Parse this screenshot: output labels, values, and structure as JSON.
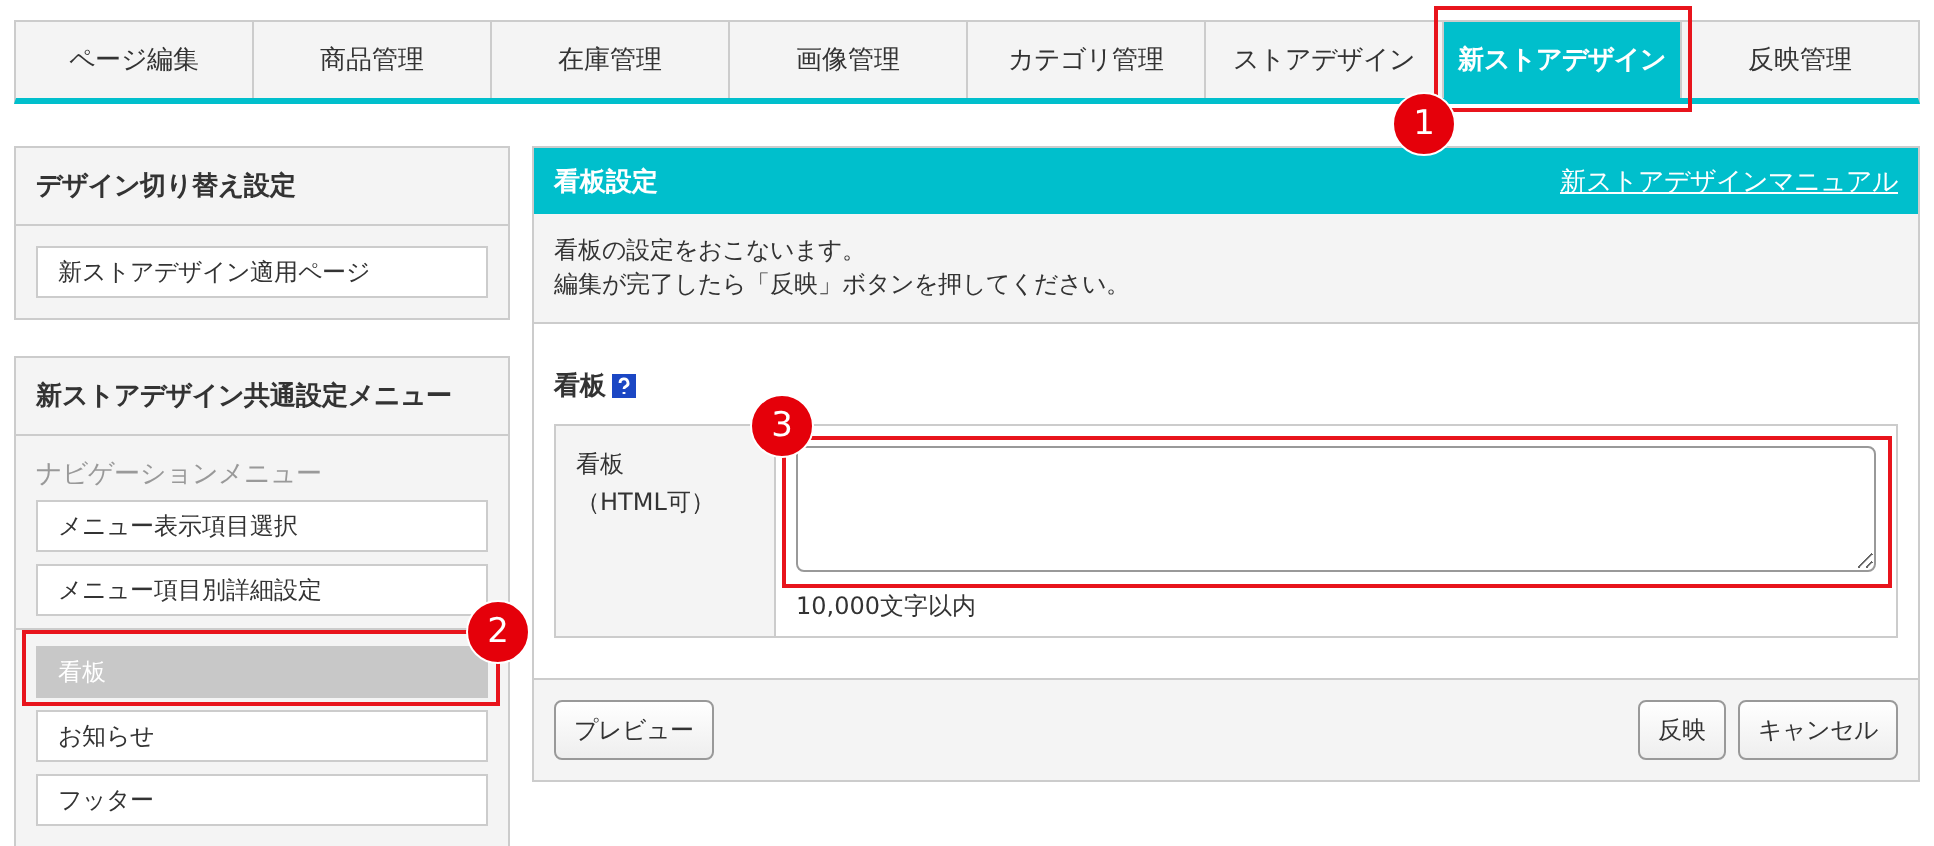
{
  "tabs": [
    {
      "label": "ページ編集",
      "selected": false
    },
    {
      "label": "商品管理",
      "selected": false
    },
    {
      "label": "在庫管理",
      "selected": false
    },
    {
      "label": "画像管理",
      "selected": false
    },
    {
      "label": "カテゴリ管理",
      "selected": false
    },
    {
      "label": "ストアデザイン",
      "selected": false
    },
    {
      "label": "新ストアデザイン",
      "selected": true
    },
    {
      "label": "反映管理",
      "selected": false
    }
  ],
  "sidebar": [
    {
      "title": "デザイン切り替え設定",
      "groups": [
        {
          "items": [
            {
              "label": "新ストアデザイン適用ページ",
              "selected": false
            }
          ]
        }
      ]
    },
    {
      "title": "新ストアデザイン共通設定メニュー",
      "groups": [
        {
          "label": "ナビゲーションメニュー",
          "items": [
            {
              "label": "メニュー表示項目選択",
              "selected": false
            },
            {
              "label": "メニュー項目別詳細設定",
              "selected": false
            }
          ]
        },
        {
          "items": [
            {
              "label": "看板",
              "selected": true
            },
            {
              "label": "お知らせ",
              "selected": false
            },
            {
              "label": "フッター",
              "selected": false
            }
          ]
        }
      ]
    }
  ],
  "main": {
    "title": "看板設定",
    "manual_link": "新ストアデザインマニュアル",
    "description": [
      "看板の設定をおこないます。",
      "編集が完了したら「反映」ボタンを押してください。"
    ],
    "section_title": "看板",
    "field": {
      "label_lines": [
        "看板",
        "（HTML可）"
      ],
      "hint": "10,000文字以内"
    },
    "buttons_left": [
      "プレビュー"
    ],
    "buttons_right": [
      "反映",
      "キャンセル"
    ]
  },
  "callouts": [
    {
      "number": "1"
    },
    {
      "number": "2"
    },
    {
      "number": "3"
    }
  ]
}
